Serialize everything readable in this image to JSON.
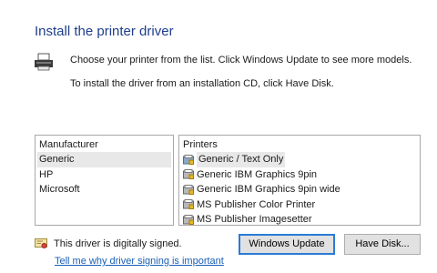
{
  "dialog": {
    "title": "Install the printer driver",
    "instruction1": "Choose your printer from the list. Click Windows Update to see more models.",
    "instruction2": "To install the driver from an installation CD, click Have Disk."
  },
  "manufacturer": {
    "header": "Manufacturer",
    "items": [
      "Generic",
      "HP",
      "Microsoft"
    ],
    "selected": "Generic"
  },
  "printers": {
    "header": "Printers",
    "items": [
      "Generic / Text Only",
      "Generic IBM Graphics 9pin",
      "Generic IBM Graphics 9pin wide",
      "MS Publisher Color Printer",
      "MS Publisher Imagesetter"
    ],
    "selected": "Generic / Text Only"
  },
  "footer": {
    "signed_text": "This driver is digitally signed.",
    "signing_link": "Tell me why driver signing is important",
    "windows_update_label": "Windows Update",
    "have_disk_label": "Have Disk..."
  },
  "icons": {
    "printer": "printer-icon",
    "driver": "printer-driver-icon",
    "signed": "certificate-icon"
  },
  "colors": {
    "title": "#1e3f8a",
    "link": "#1a5fb4",
    "focus_border": "#2a7bd6"
  }
}
